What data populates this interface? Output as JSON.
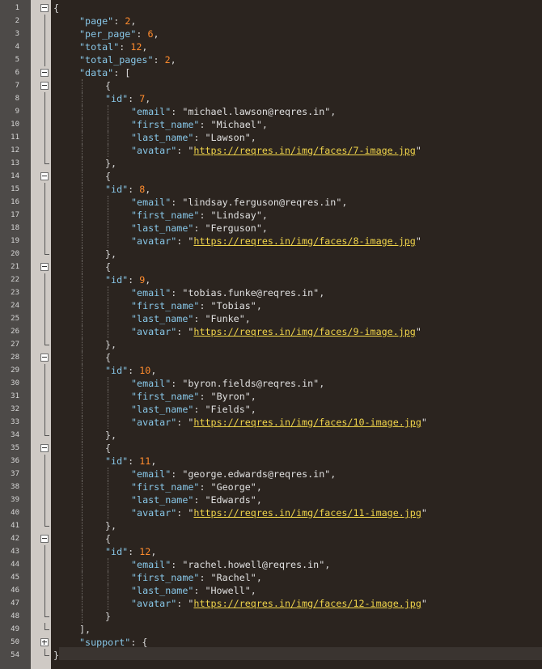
{
  "lines": [
    {
      "n": "1",
      "fold": "minus",
      "indent": 0,
      "parts": [
        {
          "t": "{",
          "c": "punc"
        }
      ]
    },
    {
      "n": "2",
      "indent": 1,
      "parts": [
        {
          "t": "\"page\"",
          "c": "key"
        },
        {
          "t": ": ",
          "c": "punc"
        },
        {
          "t": "2",
          "c": "num"
        },
        {
          "t": ",",
          "c": "punc"
        }
      ]
    },
    {
      "n": "3",
      "indent": 1,
      "parts": [
        {
          "t": "\"per_page\"",
          "c": "key"
        },
        {
          "t": ": ",
          "c": "punc"
        },
        {
          "t": "6",
          "c": "num"
        },
        {
          "t": ",",
          "c": "punc"
        }
      ]
    },
    {
      "n": "4",
      "indent": 1,
      "parts": [
        {
          "t": "\"total\"",
          "c": "key"
        },
        {
          "t": ": ",
          "c": "punc"
        },
        {
          "t": "12",
          "c": "num"
        },
        {
          "t": ",",
          "c": "punc"
        }
      ]
    },
    {
      "n": "5",
      "indent": 1,
      "parts": [
        {
          "t": "\"total_pages\"",
          "c": "key"
        },
        {
          "t": ": ",
          "c": "punc"
        },
        {
          "t": "2",
          "c": "num"
        },
        {
          "t": ",",
          "c": "punc"
        }
      ]
    },
    {
      "n": "6",
      "fold": "minus",
      "indent": 1,
      "parts": [
        {
          "t": "\"data\"",
          "c": "key"
        },
        {
          "t": ": [",
          "c": "punc"
        }
      ]
    },
    {
      "n": "7",
      "fold": "minus",
      "indent": 2,
      "parts": [
        {
          "t": "{",
          "c": "punc"
        }
      ]
    },
    {
      "n": "8",
      "indent": 2,
      "parts": [
        {
          "t": "\"id\"",
          "c": "key"
        },
        {
          "t": ": ",
          "c": "punc"
        },
        {
          "t": "7",
          "c": "num"
        },
        {
          "t": ",",
          "c": "punc"
        }
      ]
    },
    {
      "n": "9",
      "indent": 3,
      "parts": [
        {
          "t": "\"email\"",
          "c": "key"
        },
        {
          "t": ": ",
          "c": "punc"
        },
        {
          "t": "\"michael.lawson@reqres.in\"",
          "c": "str"
        },
        {
          "t": ",",
          "c": "punc"
        }
      ]
    },
    {
      "n": "10",
      "indent": 3,
      "parts": [
        {
          "t": "\"first_name\"",
          "c": "key"
        },
        {
          "t": ": ",
          "c": "punc"
        },
        {
          "t": "\"Michael\"",
          "c": "str"
        },
        {
          "t": ",",
          "c": "punc"
        }
      ]
    },
    {
      "n": "11",
      "indent": 3,
      "parts": [
        {
          "t": "\"last_name\"",
          "c": "key"
        },
        {
          "t": ": ",
          "c": "punc"
        },
        {
          "t": "\"Lawson\"",
          "c": "str"
        },
        {
          "t": ",",
          "c": "punc"
        }
      ]
    },
    {
      "n": "12",
      "indent": 3,
      "parts": [
        {
          "t": "\"avatar\"",
          "c": "key"
        },
        {
          "t": ": ",
          "c": "punc"
        },
        {
          "t": "\"",
          "c": "str"
        },
        {
          "t": "https://reqres.in/img/faces/7-image.jpg",
          "c": "url"
        },
        {
          "t": "\"",
          "c": "str"
        }
      ]
    },
    {
      "n": "13",
      "fend": true,
      "indent": 2,
      "parts": [
        {
          "t": "},",
          "c": "punc"
        }
      ]
    },
    {
      "n": "14",
      "fold": "minus",
      "indent": 2,
      "parts": [
        {
          "t": "{",
          "c": "punc"
        }
      ]
    },
    {
      "n": "15",
      "indent": 2,
      "parts": [
        {
          "t": "\"id\"",
          "c": "key"
        },
        {
          "t": ": ",
          "c": "punc"
        },
        {
          "t": "8",
          "c": "num"
        },
        {
          "t": ",",
          "c": "punc"
        }
      ]
    },
    {
      "n": "16",
      "indent": 3,
      "parts": [
        {
          "t": "\"email\"",
          "c": "key"
        },
        {
          "t": ": ",
          "c": "punc"
        },
        {
          "t": "\"lindsay.ferguson@reqres.in\"",
          "c": "str"
        },
        {
          "t": ",",
          "c": "punc"
        }
      ]
    },
    {
      "n": "17",
      "indent": 3,
      "parts": [
        {
          "t": "\"first_name\"",
          "c": "key"
        },
        {
          "t": ": ",
          "c": "punc"
        },
        {
          "t": "\"Lindsay\"",
          "c": "str"
        },
        {
          "t": ",",
          "c": "punc"
        }
      ]
    },
    {
      "n": "18",
      "indent": 3,
      "parts": [
        {
          "t": "\"last_name\"",
          "c": "key"
        },
        {
          "t": ": ",
          "c": "punc"
        },
        {
          "t": "\"Ferguson\"",
          "c": "str"
        },
        {
          "t": ",",
          "c": "punc"
        }
      ]
    },
    {
      "n": "19",
      "indent": 3,
      "parts": [
        {
          "t": "\"avatar\"",
          "c": "key"
        },
        {
          "t": ": ",
          "c": "punc"
        },
        {
          "t": "\"",
          "c": "str"
        },
        {
          "t": "https://reqres.in/img/faces/8-image.jpg",
          "c": "url"
        },
        {
          "t": "\"",
          "c": "str"
        }
      ]
    },
    {
      "n": "20",
      "fend": true,
      "indent": 2,
      "parts": [
        {
          "t": "},",
          "c": "punc"
        }
      ]
    },
    {
      "n": "21",
      "fold": "minus",
      "indent": 2,
      "parts": [
        {
          "t": "{",
          "c": "punc"
        }
      ]
    },
    {
      "n": "22",
      "indent": 2,
      "parts": [
        {
          "t": "\"id\"",
          "c": "key"
        },
        {
          "t": ": ",
          "c": "punc"
        },
        {
          "t": "9",
          "c": "num"
        },
        {
          "t": ",",
          "c": "punc"
        }
      ]
    },
    {
      "n": "23",
      "indent": 3,
      "parts": [
        {
          "t": "\"email\"",
          "c": "key"
        },
        {
          "t": ": ",
          "c": "punc"
        },
        {
          "t": "\"tobias.funke@reqres.in\"",
          "c": "str"
        },
        {
          "t": ",",
          "c": "punc"
        }
      ]
    },
    {
      "n": "24",
      "indent": 3,
      "parts": [
        {
          "t": "\"first_name\"",
          "c": "key"
        },
        {
          "t": ": ",
          "c": "punc"
        },
        {
          "t": "\"Tobias\"",
          "c": "str"
        },
        {
          "t": ",",
          "c": "punc"
        }
      ]
    },
    {
      "n": "25",
      "indent": 3,
      "parts": [
        {
          "t": "\"last_name\"",
          "c": "key"
        },
        {
          "t": ": ",
          "c": "punc"
        },
        {
          "t": "\"Funke\"",
          "c": "str"
        },
        {
          "t": ",",
          "c": "punc"
        }
      ]
    },
    {
      "n": "26",
      "indent": 3,
      "parts": [
        {
          "t": "\"avatar\"",
          "c": "key"
        },
        {
          "t": ": ",
          "c": "punc"
        },
        {
          "t": "\"",
          "c": "str"
        },
        {
          "t": "https://reqres.in/img/faces/9-image.jpg",
          "c": "url"
        },
        {
          "t": "\"",
          "c": "str"
        }
      ]
    },
    {
      "n": "27",
      "fend": true,
      "indent": 2,
      "parts": [
        {
          "t": "},",
          "c": "punc"
        }
      ]
    },
    {
      "n": "28",
      "fold": "minus",
      "indent": 2,
      "parts": [
        {
          "t": "{",
          "c": "punc"
        }
      ]
    },
    {
      "n": "29",
      "indent": 2,
      "parts": [
        {
          "t": "\"id\"",
          "c": "key"
        },
        {
          "t": ": ",
          "c": "punc"
        },
        {
          "t": "10",
          "c": "num"
        },
        {
          "t": ",",
          "c": "punc"
        }
      ]
    },
    {
      "n": "30",
      "indent": 3,
      "parts": [
        {
          "t": "\"email\"",
          "c": "key"
        },
        {
          "t": ": ",
          "c": "punc"
        },
        {
          "t": "\"byron.fields@reqres.in\"",
          "c": "str"
        },
        {
          "t": ",",
          "c": "punc"
        }
      ]
    },
    {
      "n": "31",
      "indent": 3,
      "parts": [
        {
          "t": "\"first_name\"",
          "c": "key"
        },
        {
          "t": ": ",
          "c": "punc"
        },
        {
          "t": "\"Byron\"",
          "c": "str"
        },
        {
          "t": ",",
          "c": "punc"
        }
      ]
    },
    {
      "n": "32",
      "indent": 3,
      "parts": [
        {
          "t": "\"last_name\"",
          "c": "key"
        },
        {
          "t": ": ",
          "c": "punc"
        },
        {
          "t": "\"Fields\"",
          "c": "str"
        },
        {
          "t": ",",
          "c": "punc"
        }
      ]
    },
    {
      "n": "33",
      "indent": 3,
      "parts": [
        {
          "t": "\"avatar\"",
          "c": "key"
        },
        {
          "t": ": ",
          "c": "punc"
        },
        {
          "t": "\"",
          "c": "str"
        },
        {
          "t": "https://reqres.in/img/faces/10-image.jpg",
          "c": "url"
        },
        {
          "t": "\"",
          "c": "str"
        }
      ]
    },
    {
      "n": "34",
      "fend": true,
      "indent": 2,
      "parts": [
        {
          "t": "},",
          "c": "punc"
        }
      ]
    },
    {
      "n": "35",
      "fold": "minus",
      "indent": 2,
      "parts": [
        {
          "t": "{",
          "c": "punc"
        }
      ]
    },
    {
      "n": "36",
      "indent": 2,
      "parts": [
        {
          "t": "\"id\"",
          "c": "key"
        },
        {
          "t": ": ",
          "c": "punc"
        },
        {
          "t": "11",
          "c": "num"
        },
        {
          "t": ",",
          "c": "punc"
        }
      ]
    },
    {
      "n": "37",
      "indent": 3,
      "parts": [
        {
          "t": "\"email\"",
          "c": "key"
        },
        {
          "t": ": ",
          "c": "punc"
        },
        {
          "t": "\"george.edwards@reqres.in\"",
          "c": "str"
        },
        {
          "t": ",",
          "c": "punc"
        }
      ]
    },
    {
      "n": "38",
      "indent": 3,
      "parts": [
        {
          "t": "\"first_name\"",
          "c": "key"
        },
        {
          "t": ": ",
          "c": "punc"
        },
        {
          "t": "\"George\"",
          "c": "str"
        },
        {
          "t": ",",
          "c": "punc"
        }
      ]
    },
    {
      "n": "39",
      "indent": 3,
      "parts": [
        {
          "t": "\"last_name\"",
          "c": "key"
        },
        {
          "t": ": ",
          "c": "punc"
        },
        {
          "t": "\"Edwards\"",
          "c": "str"
        },
        {
          "t": ",",
          "c": "punc"
        }
      ]
    },
    {
      "n": "40",
      "indent": 3,
      "parts": [
        {
          "t": "\"avatar\"",
          "c": "key"
        },
        {
          "t": ": ",
          "c": "punc"
        },
        {
          "t": "\"",
          "c": "str"
        },
        {
          "t": "https://reqres.in/img/faces/11-image.jpg",
          "c": "url"
        },
        {
          "t": "\"",
          "c": "str"
        }
      ]
    },
    {
      "n": "41",
      "fend": true,
      "indent": 2,
      "parts": [
        {
          "t": "},",
          "c": "punc"
        }
      ]
    },
    {
      "n": "42",
      "fold": "minus",
      "indent": 2,
      "parts": [
        {
          "t": "{",
          "c": "punc"
        }
      ]
    },
    {
      "n": "43",
      "indent": 2,
      "parts": [
        {
          "t": "\"id\"",
          "c": "key"
        },
        {
          "t": ": ",
          "c": "punc"
        },
        {
          "t": "12",
          "c": "num"
        },
        {
          "t": ",",
          "c": "punc"
        }
      ]
    },
    {
      "n": "44",
      "indent": 3,
      "parts": [
        {
          "t": "\"email\"",
          "c": "key"
        },
        {
          "t": ": ",
          "c": "punc"
        },
        {
          "t": "\"rachel.howell@reqres.in\"",
          "c": "str"
        },
        {
          "t": ",",
          "c": "punc"
        }
      ]
    },
    {
      "n": "45",
      "indent": 3,
      "parts": [
        {
          "t": "\"first_name\"",
          "c": "key"
        },
        {
          "t": ": ",
          "c": "punc"
        },
        {
          "t": "\"Rachel\"",
          "c": "str"
        },
        {
          "t": ",",
          "c": "punc"
        }
      ]
    },
    {
      "n": "46",
      "indent": 3,
      "parts": [
        {
          "t": "\"last_name\"",
          "c": "key"
        },
        {
          "t": ": ",
          "c": "punc"
        },
        {
          "t": "\"Howell\"",
          "c": "str"
        },
        {
          "t": ",",
          "c": "punc"
        }
      ]
    },
    {
      "n": "47",
      "indent": 3,
      "parts": [
        {
          "t": "\"avatar\"",
          "c": "key"
        },
        {
          "t": ": ",
          "c": "punc"
        },
        {
          "t": "\"",
          "c": "str"
        },
        {
          "t": "https://reqres.in/img/faces/12-image.jpg",
          "c": "url"
        },
        {
          "t": "\"",
          "c": "str"
        }
      ]
    },
    {
      "n": "48",
      "fend": true,
      "indent": 2,
      "parts": [
        {
          "t": "}",
          "c": "punc"
        }
      ]
    },
    {
      "n": "49",
      "fend": true,
      "indent": 1,
      "parts": [
        {
          "t": "],",
          "c": "punc"
        }
      ]
    },
    {
      "n": "50",
      "fold": "plus",
      "indent": 1,
      "parts": [
        {
          "t": "\"support\"",
          "c": "key"
        },
        {
          "t": ": {",
          "c": "punc"
        }
      ]
    },
    {
      "n": "54",
      "fend": true,
      "indent": 0,
      "parts": [
        {
          "t": "}",
          "c": "punc"
        }
      ]
    }
  ]
}
